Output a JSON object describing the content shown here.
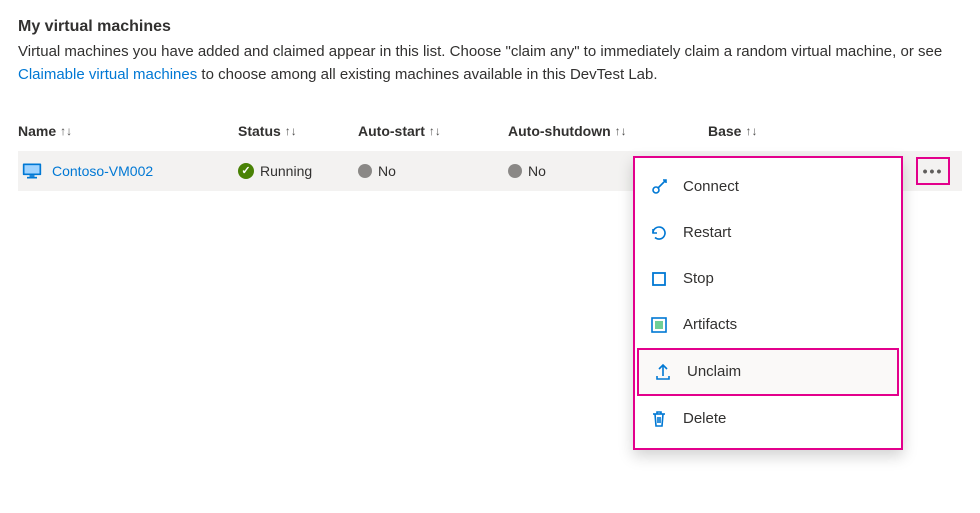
{
  "section": {
    "title": "My virtual machines",
    "description_before_link": "Virtual machines you have added and claimed appear in this list. Choose \"claim any\" to immediately claim a random virtual machine, or see ",
    "link_text": "Claimable virtual machines",
    "description_after_link": " to choose among all existing machines available in this DevTest Lab."
  },
  "columns": {
    "name": "Name",
    "status": "Status",
    "autostart": "Auto-start",
    "autoshutdown": "Auto-shutdown",
    "base": "Base"
  },
  "row": {
    "vm_name": "Contoso-VM002",
    "status": "Running",
    "autostart": "No",
    "autoshutdown": "No",
    "base": ""
  },
  "menu": {
    "connect": "Connect",
    "restart": "Restart",
    "stop": "Stop",
    "artifacts": "Artifacts",
    "unclaim": "Unclaim",
    "delete": "Delete"
  }
}
